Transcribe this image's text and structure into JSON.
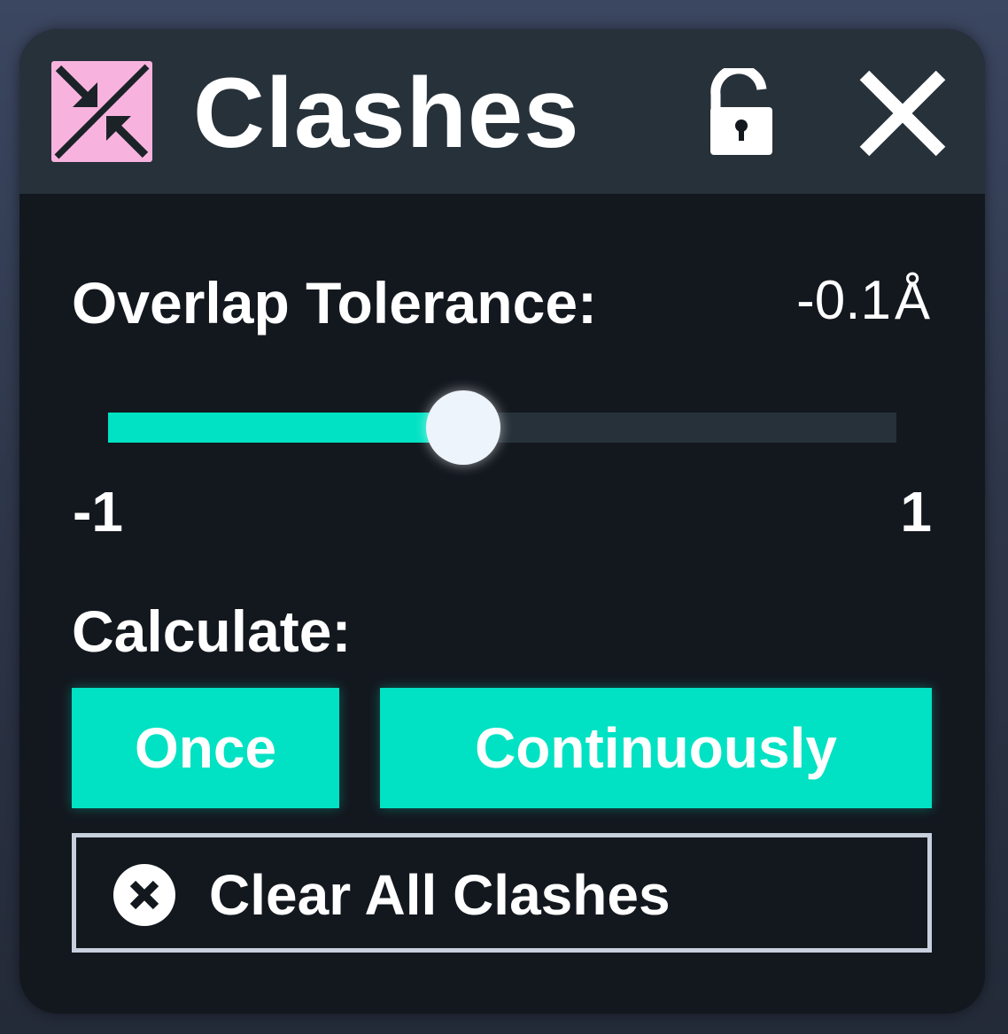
{
  "window": {
    "title": "Clashes",
    "icon": "clashes-icon",
    "lock_icon": "unlock-icon",
    "close_icon": "close-icon",
    "icon_color": "#f7b3de"
  },
  "tolerance": {
    "label": "Overlap Tolerance:",
    "value": "-0.1",
    "unit": "Å",
    "min_label": "-1",
    "max_label": "1",
    "fraction": 0.45
  },
  "calculate": {
    "label": "Calculate:",
    "once_label": "Once",
    "continuously_label": "Continuously"
  },
  "clear": {
    "label": "Clear All Clashes",
    "icon": "clear-x-circle-icon"
  },
  "colors": {
    "accent": "#00e2c3",
    "panel": "#13181f",
    "header": "#26313a"
  }
}
